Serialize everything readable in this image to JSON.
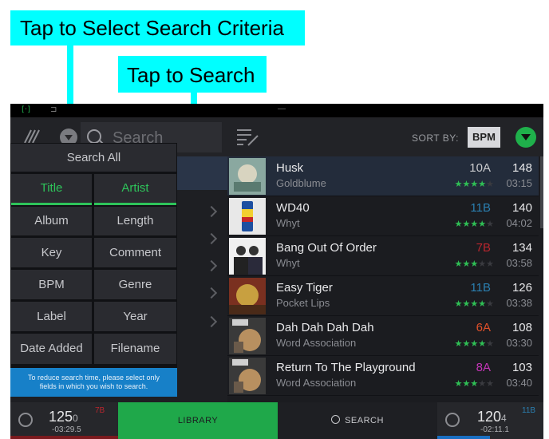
{
  "callouts": {
    "select_criteria": "Tap to Select Search Criteria",
    "tap_to_search": "Tap to Search"
  },
  "toolbar": {
    "search_placeholder": "Search",
    "sort_by_label": "SORT BY:",
    "sort_by_value": "BPM"
  },
  "criteria_popup": {
    "search_all": "Search All",
    "fields": [
      {
        "label": "Title",
        "selected": true
      },
      {
        "label": "Artist",
        "selected": true
      },
      {
        "label": "Album",
        "selected": false
      },
      {
        "label": "Length",
        "selected": false
      },
      {
        "label": "Key",
        "selected": false
      },
      {
        "label": "Comment",
        "selected": false
      },
      {
        "label": "BPM",
        "selected": false
      },
      {
        "label": "Genre",
        "selected": false
      },
      {
        "label": "Label",
        "selected": false
      },
      {
        "label": "Year",
        "selected": false
      },
      {
        "label": "Date Added",
        "selected": false
      },
      {
        "label": "Filename",
        "selected": false
      }
    ],
    "note_line1": "To reduce search time, please select only",
    "note_line2": "fields in which you wish to search."
  },
  "tracks": [
    {
      "title": "Husk",
      "artist": "Goldblume",
      "key": "10A",
      "key_color": "#c9cacd",
      "rating": 4,
      "bpm": "148",
      "time": "03:15"
    },
    {
      "title": "WD40",
      "artist": "Whyt",
      "key": "11B",
      "key_color": "#2b7fb0",
      "rating": 4,
      "bpm": "140",
      "time": "04:02"
    },
    {
      "title": "Bang Out Of Order",
      "artist": "Whyt",
      "key": "7B",
      "key_color": "#b8262e",
      "rating": 3,
      "bpm": "134",
      "time": "03:58"
    },
    {
      "title": "Easy Tiger",
      "artist": "Pocket Lips",
      "key": "11B",
      "key_color": "#2b7fb0",
      "rating": 4,
      "bpm": "126",
      "time": "03:38"
    },
    {
      "title": "Dah Dah Dah Dah",
      "artist": "Word Association",
      "key": "6A",
      "key_color": "#e0502a",
      "rating": 4,
      "bpm": "108",
      "time": "03:30"
    },
    {
      "title": "Return To The Playground",
      "artist": "Word Association",
      "key": "8A",
      "key_color": "#c535b8",
      "rating": 3,
      "bpm": "103",
      "time": "03:40"
    }
  ],
  "bottom_bar": {
    "deck_left": {
      "bpm_main": "125",
      "bpm_decimal": "0",
      "time": "-03:29.5",
      "key": "7B",
      "key_color": "#b8262e",
      "bar_color": "#b8262e"
    },
    "library_label": "LIBRARY",
    "search_label": "SEARCH",
    "deck_right": {
      "bpm_main": "120",
      "bpm_decimal": "4",
      "time": "-02:11.1",
      "key": "11B",
      "key_color": "#2b7fb0",
      "bar_color": "#1a6fc2"
    }
  },
  "colors": {
    "callout": "#00ffff",
    "accent_green": "#1fa84a",
    "note_blue": "#1780c8"
  }
}
